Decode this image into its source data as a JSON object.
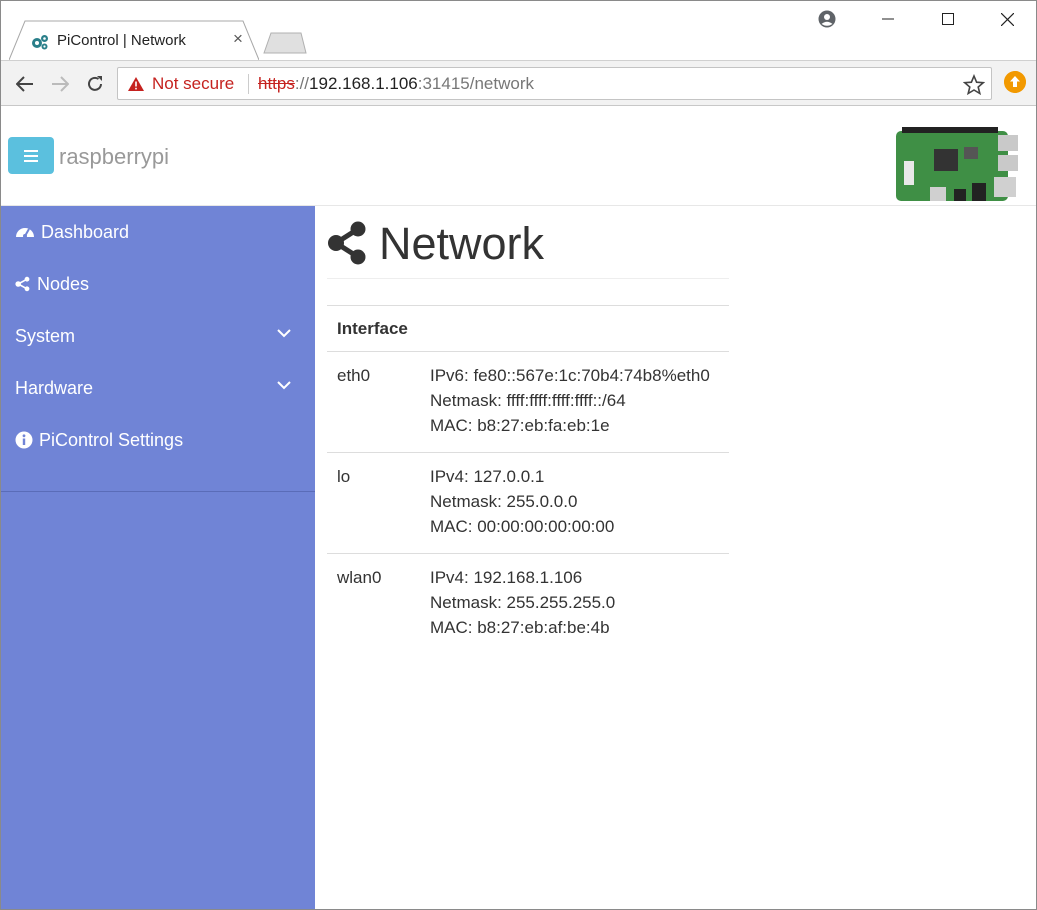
{
  "browser": {
    "tab_title": "PiControl | Network",
    "tab_close": "×",
    "security_label": "Not secure",
    "url_scheme": "https",
    "url_sep": "://",
    "url_host": "192.168.1.106",
    "url_rest": ":31415/network"
  },
  "header": {
    "brand": "raspberrypi"
  },
  "sidebar": {
    "items": [
      {
        "label": "Dashboard",
        "icon": "dashboard-icon"
      },
      {
        "label": "Nodes",
        "icon": "share-icon"
      },
      {
        "label": "System",
        "icon": "chevron-down-icon"
      },
      {
        "label": "Hardware",
        "icon": "chevron-down-icon"
      },
      {
        "label": "PiControl Settings",
        "icon": "info-circle-icon"
      }
    ]
  },
  "main": {
    "title": "Network",
    "table": {
      "header": "Interface",
      "rows": [
        {
          "iface": "eth0",
          "lines": [
            "IPv6: fe80::567e:1c:70b4:74b8%eth0",
            "Netmask: ffff:ffff:ffff:ffff::/64",
            "MAC: b8:27:eb:fa:eb:1e"
          ]
        },
        {
          "iface": "lo",
          "lines": [
            "IPv4: 127.0.0.1",
            "Netmask: 255.0.0.0",
            "MAC: 00:00:00:00:00:00"
          ]
        },
        {
          "iface": "wlan0",
          "lines": [
            "IPv4: 192.168.1.106",
            "Netmask: 255.255.255.0",
            "MAC: b8:27:eb:af:be:4b"
          ]
        }
      ]
    }
  },
  "colors": {
    "sidebar_bg": "#7084d6",
    "menu_toggle": "#5bc0de",
    "warning": "#c5221f"
  }
}
